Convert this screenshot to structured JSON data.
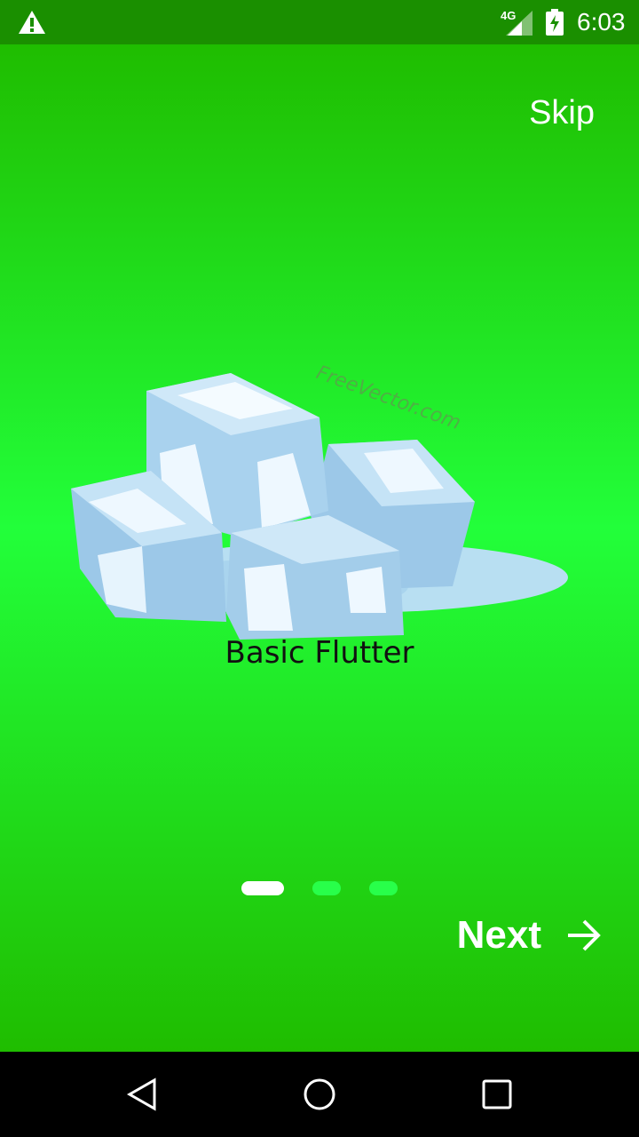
{
  "status_bar": {
    "network": "4G",
    "time": "6:03",
    "icons": [
      "warning-icon",
      "signal-icon",
      "battery-charging-icon"
    ]
  },
  "onboarding": {
    "skip_label": "Skip",
    "illustration_watermark": "FreeVector.com",
    "caption": "Basic Flutter",
    "next_label": "Next",
    "page_count": 3,
    "active_page": 1
  },
  "nav_bar": {
    "icons": [
      "back-icon",
      "home-icon",
      "recent-apps-icon"
    ]
  },
  "colors": {
    "status_bar": "#1a8f00",
    "bg_edge": "#1fbd00",
    "bg_center": "#22ff3a",
    "indicator_active": "#ffffff",
    "indicator_inactive": "#28ff4a"
  }
}
